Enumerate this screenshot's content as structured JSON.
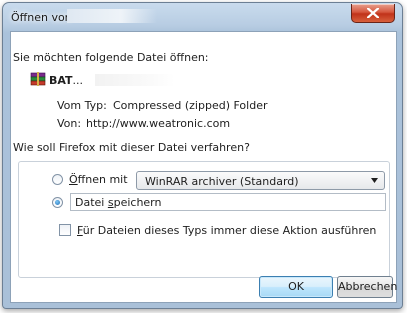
{
  "window": {
    "title": "Öffnen von",
    "close_glyph": "✕"
  },
  "intro_text": "Sie möchten folgende Datei öffnen:",
  "file": {
    "icon": "winrar-archive-icon",
    "name": "BAT",
    "name_suffix": "...",
    "type_label": "Vom Typ:",
    "type_value": "Compressed (zipped) Folder",
    "source_label": "Von:",
    "source_value": "http://www.weatronic.com"
  },
  "question": "Wie soll Firefox mit dieser Datei verfahren?",
  "options": {
    "open_with": {
      "label_mnemonic": "Ö",
      "label_rest": "ffnen mit",
      "selected": false,
      "app_value": "WinRAR archiver (Standard)"
    },
    "save": {
      "label_start": "Datei ",
      "label_mnemonic": "s",
      "label_rest": "peichern",
      "selected": true
    }
  },
  "remember": {
    "label_mnemonic": "F",
    "label_rest": "ür Dateien dieses Typs immer diese Aktion ausführen",
    "checked": false
  },
  "buttons": {
    "ok": "OK",
    "cancel": "Abbrechen"
  },
  "colors": {
    "titlebar": "#b8cde3",
    "close_button": "#c0321a",
    "ok_focus": "#3c7fb1"
  }
}
